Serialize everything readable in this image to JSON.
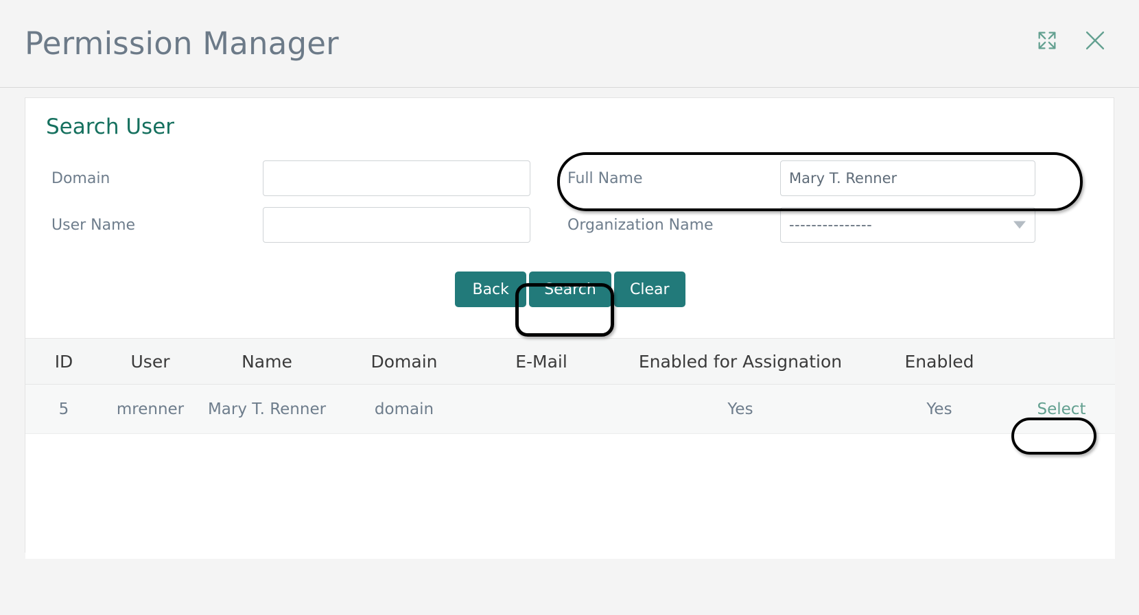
{
  "window": {
    "title": "Permission Manager",
    "expand_icon": "expand-icon",
    "close_icon": "close-icon"
  },
  "section": {
    "title": "Search User"
  },
  "form": {
    "domain": {
      "label": "Domain",
      "value": "",
      "placeholder": ""
    },
    "user_name": {
      "label": "User Name",
      "value": "",
      "placeholder": ""
    },
    "full_name": {
      "label": "Full Name",
      "value": "Mary T. Renner",
      "placeholder": ""
    },
    "organization_name": {
      "label": "Organization Name",
      "value": "---------------",
      "options": [
        "---------------"
      ]
    }
  },
  "buttons": {
    "back": "Back",
    "search": "Search",
    "clear": "Clear"
  },
  "table": {
    "columns": [
      "ID",
      "User",
      "Name",
      "Domain",
      "E-Mail",
      "Enabled for Assignation",
      "Enabled"
    ],
    "rows": [
      {
        "id": "5",
        "user": "mrenner",
        "name": "Mary T. Renner",
        "domain": "domain",
        "email": "",
        "enabled_for_assignation": "Yes",
        "enabled": "Yes",
        "action": "Select"
      }
    ]
  },
  "colors": {
    "accent_teal": "#227a7a",
    "section_title": "#15705e",
    "text_muted": "#6e7d8c",
    "link": "#63a090",
    "page_bg": "#f4f4f4"
  }
}
